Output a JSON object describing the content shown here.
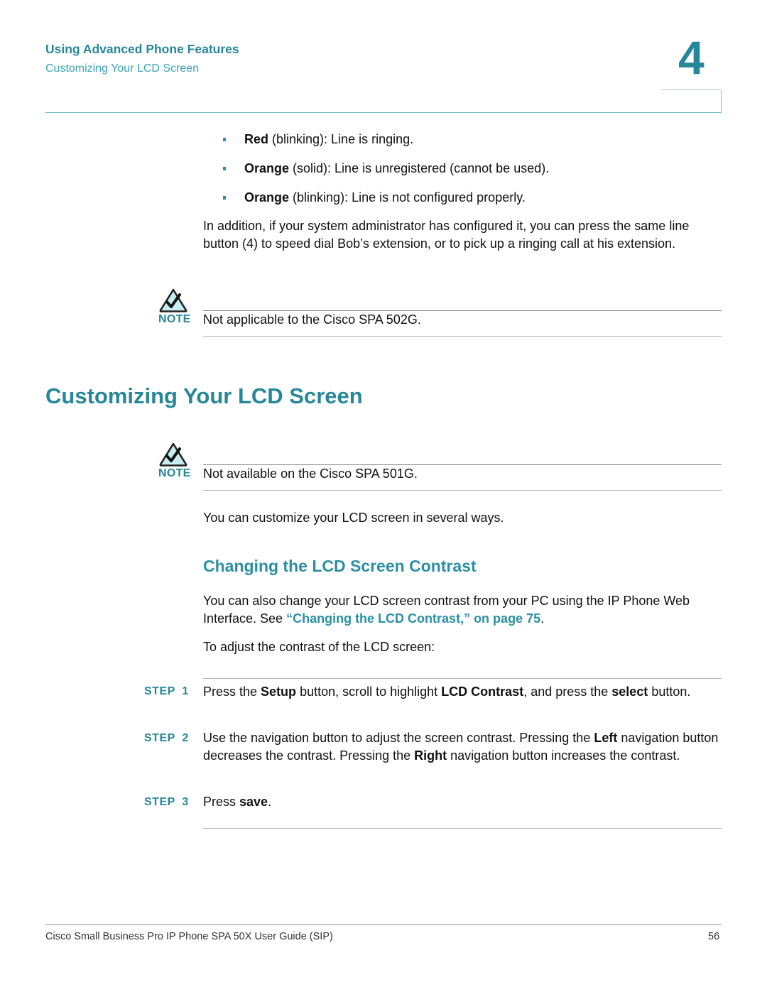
{
  "header": {
    "section": "Using Advanced Phone Features",
    "subsection": "Customizing Your LCD Screen",
    "chapter_number": "4"
  },
  "bullets": [
    {
      "bold": "Red",
      "text": " (blinking): Line is ringing."
    },
    {
      "bold": "Orange",
      "text": " (solid): Line is unregistered (cannot be used)."
    },
    {
      "bold": "Orange",
      "text": " (blinking): Line is not configured properly."
    }
  ],
  "intro_paragraph": "In addition, if your system administrator has configured it, you can press the same line button (4) to speed dial Bob’s extension, or to pick up a ringing call at his extension.",
  "notes": [
    {
      "label": "NOTE",
      "icon": "checkmark-warning-triangle-icon",
      "text": "Not applicable to the Cisco SPA 502G."
    },
    {
      "label": "NOTE",
      "icon": "checkmark-warning-triangle-icon",
      "text": "Not available on the Cisco SPA 501G."
    }
  ],
  "section_title": "Customizing Your LCD Screen",
  "section_intro": "You can customize your LCD screen in several ways.",
  "subsection_title": "Changing the LCD Screen Contrast",
  "contrast_paragraph": {
    "before": "You can also change your LCD screen contrast from your PC using the IP Phone Web Interface. See ",
    "link": "“Changing the LCD Contrast,” on page 75",
    "after": "."
  },
  "adjust_intro": "To adjust the contrast of the LCD screen:",
  "steps": [
    {
      "label": "STEP  1",
      "parts": [
        {
          "t": "Press the "
        },
        {
          "b": "Setup"
        },
        {
          "t": " button, scroll to highlight "
        },
        {
          "b": "LCD Contrast"
        },
        {
          "t": ", and press the "
        },
        {
          "b": "select"
        },
        {
          "t": " button."
        }
      ]
    },
    {
      "label": "STEP  2",
      "parts": [
        {
          "t": "Use the navigation button to adjust the screen contrast. Pressing the "
        },
        {
          "b": "Left"
        },
        {
          "t": " navigation button decreases the contrast. Pressing the "
        },
        {
          "b": "Right"
        },
        {
          "t": " navigation button increases the contrast."
        }
      ]
    },
    {
      "label": "STEP  3",
      "parts": [
        {
          "t": "Press "
        },
        {
          "b": "save"
        },
        {
          "t": "."
        }
      ]
    }
  ],
  "footer": {
    "title": "Cisco Small Business Pro IP Phone SPA 50X User Guide (SIP)",
    "page": "56"
  },
  "colors": {
    "accent": "#27879a",
    "accent_light": "#3aa3b3",
    "note_icon_fill": "#c6eef0"
  }
}
